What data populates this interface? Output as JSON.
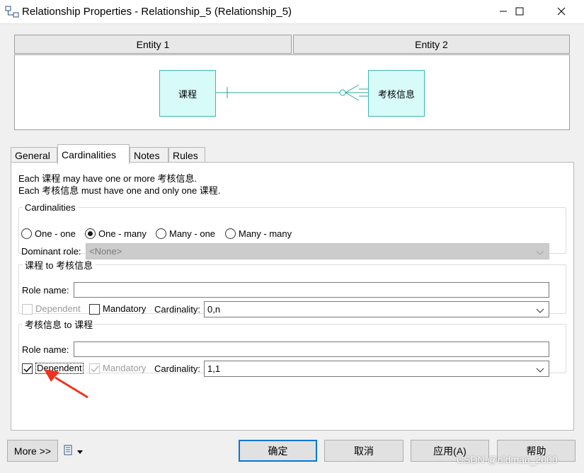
{
  "window": {
    "title": "Relationship Properties - Relationship_5 (Relationship_5)"
  },
  "entities": {
    "entity1_header": "Entity 1",
    "entity2_header": "Entity 2",
    "entity1_name": "课程",
    "entity2_name": "考核信息"
  },
  "tabs": [
    {
      "label": "General"
    },
    {
      "label": "Cardinalities"
    },
    {
      "label": "Notes"
    },
    {
      "label": "Rules"
    }
  ],
  "description": {
    "line1": "Each 课程 may have one or more 考核信息.",
    "line2": "Each 考核信息 must have one and only one 课程."
  },
  "cardinalities": {
    "legend": "Cardinalities",
    "options": [
      {
        "label": "One - one",
        "selected": false
      },
      {
        "label": "One - many",
        "selected": true
      },
      {
        "label": "Many - one",
        "selected": false
      },
      {
        "label": "Many - many",
        "selected": false
      }
    ],
    "dominant_role_label": "Dominant role:",
    "dominant_role_value": "<None>"
  },
  "role1": {
    "legend": "课程 to 考核信息",
    "role_name_label": "Role name:",
    "role_name_value": "",
    "dependent_label": "Dependent",
    "dependent_checked": false,
    "mandatory_label": "Mandatory",
    "mandatory_checked": false,
    "cardinality_label": "Cardinality:",
    "cardinality_value": "0,n"
  },
  "role2": {
    "legend": "考核信息 to 课程",
    "role_name_label": "Role name:",
    "role_name_value": "",
    "dependent_label": "Dependent",
    "dependent_checked": true,
    "mandatory_label": "Mandatory",
    "mandatory_checked": true,
    "cardinality_label": "Cardinality:",
    "cardinality_value": "1,1"
  },
  "footer": {
    "more_label": "More >>",
    "ok_label": "确定",
    "cancel_label": "取消",
    "apply_label": "应用(A)",
    "help_label": "帮助",
    "watermark": "CSDN @oldmao_2000"
  },
  "colors": {
    "entity_fill": "#d7fbf8",
    "entity_border": "#3fb7ad",
    "relation_line": "#2aa79b",
    "annotation_arrow": "#f0321e",
    "default_button_border": "#0078d7"
  },
  "icons": {
    "app": "relationship-icon",
    "print": "print-properties-icon",
    "dropdown": "chevron-down-icon"
  }
}
